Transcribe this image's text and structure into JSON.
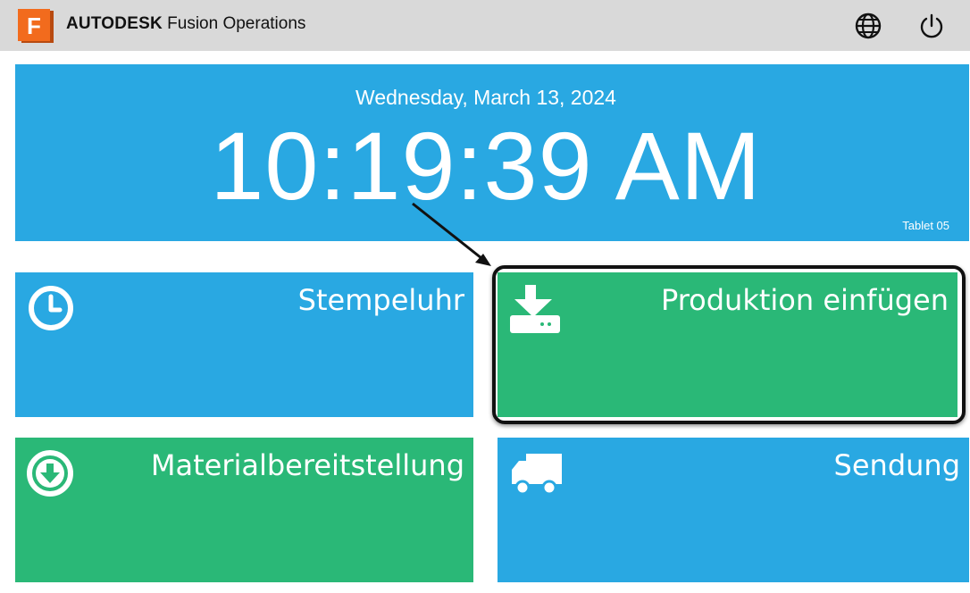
{
  "header": {
    "logo_letter": "F",
    "brand": "AUTODESK",
    "product": "Fusion Operations",
    "globe_icon": "globe-icon",
    "power_icon": "power-icon",
    "brand_color": "#f26b1d"
  },
  "clock": {
    "date": "Wednesday, March 13, 2024",
    "time": "10:19:39 AM",
    "device": "Tablet 05"
  },
  "tiles": [
    {
      "label": "Stempeluhr",
      "icon": "clock-icon",
      "color": "#29a8e2"
    },
    {
      "label": "Produktion einfügen",
      "icon": "download-tray-icon",
      "color": "#2ab877"
    },
    {
      "label": "Materialbereitstellung",
      "icon": "download-circle-icon",
      "color": "#2ab877"
    },
    {
      "label": "Sendung",
      "icon": "truck-icon",
      "color": "#29a8e2"
    }
  ]
}
